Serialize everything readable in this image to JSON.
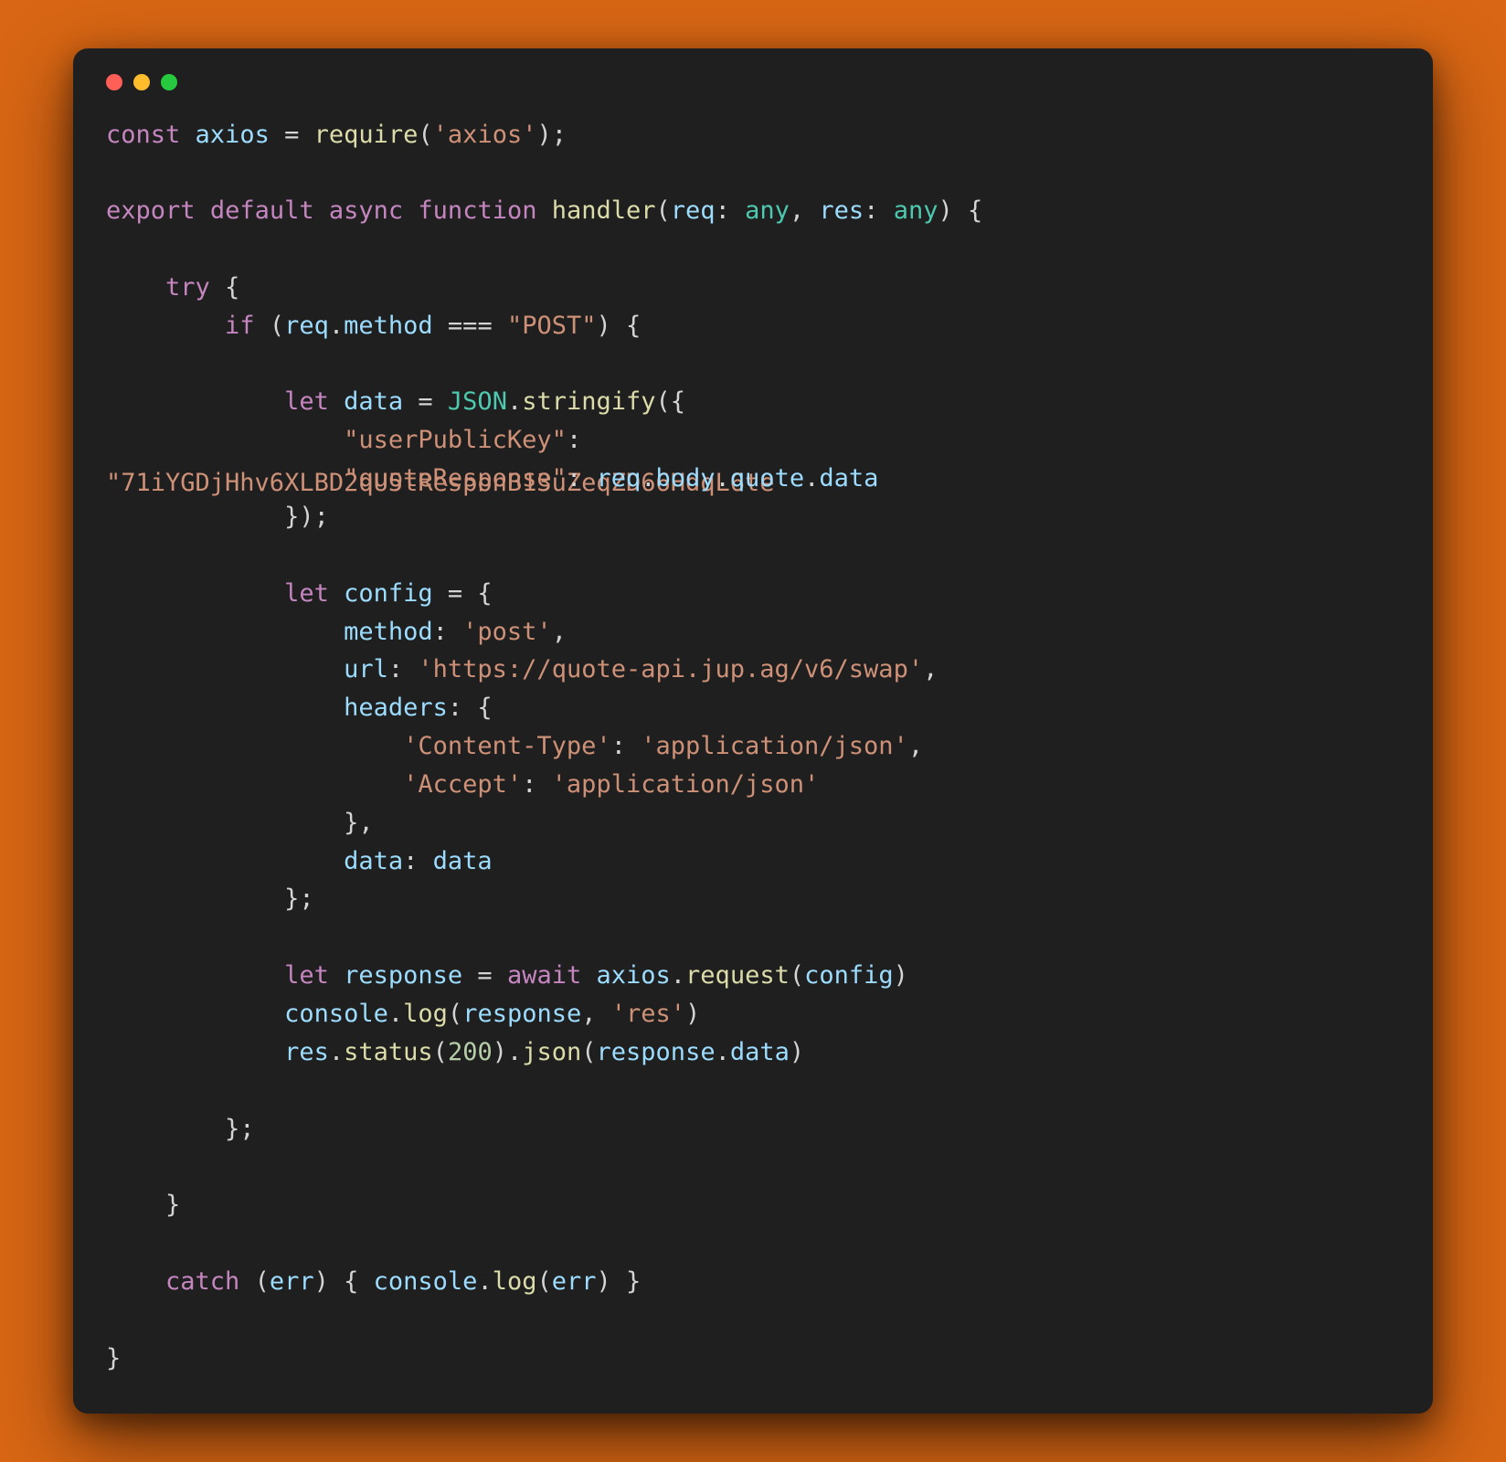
{
  "traffic_lights": {
    "red": "#ff5f56",
    "yellow": "#ffbd2e",
    "green": "#27c93f"
  },
  "code": {
    "l1": {
      "const": "const",
      "axios": "axios",
      "eq": " = ",
      "require": "require",
      "p1": "(",
      "str": "'axios'",
      "p2": ");"
    },
    "l3": {
      "export": "export",
      "default": "default",
      "async": "async",
      "function": "function",
      "handler": "handler",
      "p1": "(",
      "req": "req",
      "c1": ": ",
      "any1": "any",
      "comma": ", ",
      "res": "res",
      "c2": ": ",
      "any2": "any",
      "p2": ") {"
    },
    "l5": {
      "indent": "    ",
      "try": "try",
      "brace": " {"
    },
    "l6": {
      "indent": "        ",
      "if": "if",
      "p1": " (",
      "req": "req",
      "dot": ".",
      "method": "method",
      "eq": " === ",
      "str": "\"POST\"",
      "p2": ") {"
    },
    "l8": {
      "indent": "            ",
      "let": "let",
      "data": " data",
      "eq": " = ",
      "json": "JSON",
      "dot": ".",
      "stringify": "stringify",
      "p": "({"
    },
    "l9": {
      "indent": "                ",
      "key": "\"userPublicKey\"",
      "colon": ":"
    },
    "l10a": {
      "str_full": "\"71iYGDjHhv6XLBD2qU5tResponB13uZeqZD66HdqL6te",
      "indent2": "                ",
      "key2": "\"quoteResponse\"",
      "colon2": ": ",
      "req": "req",
      "d1": ".",
      "body": "body",
      "d2": ".",
      "quote": "quote",
      "d3": ".",
      "data": "data"
    },
    "l11": {
      "indent": "            ",
      "close": "});"
    },
    "l13": {
      "indent": "            ",
      "let": "let",
      "config": " config",
      "eq": " = {"
    },
    "l14": {
      "indent": "                ",
      "method": "method",
      "colon": ": ",
      "str": "'post'",
      "comma": ","
    },
    "l15": {
      "indent": "                ",
      "url": "url",
      "colon": ": ",
      "str": "'https://quote-api.jup.ag/v6/swap'",
      "comma": ","
    },
    "l16": {
      "indent": "                ",
      "headers": "headers",
      "colon": ": {"
    },
    "l17": {
      "indent": "                    ",
      "k": "'Content-Type'",
      "colon": ": ",
      "v": "'application/json'",
      "comma": ","
    },
    "l18": {
      "indent": "                    ",
      "k": "'Accept'",
      "colon": ": ",
      "v": "'application/json'"
    },
    "l19": {
      "indent": "                ",
      "close": "},"
    },
    "l20": {
      "indent": "                ",
      "data": "data",
      "colon": ": ",
      "data2": "data"
    },
    "l21": {
      "indent": "            ",
      "close": "};"
    },
    "l23": {
      "indent": "            ",
      "let": "let",
      "response": " response",
      "eq": " = ",
      "await": "await",
      "sp": " ",
      "axios": "axios",
      "dot": ".",
      "request": "request",
      "p1": "(",
      "config": "config",
      "p2": ")"
    },
    "l24": {
      "indent": "            ",
      "console": "console",
      "dot": ".",
      "log": "log",
      "p1": "(",
      "response": "response",
      "comma": ", ",
      "str": "'res'",
      "p2": ")"
    },
    "l25": {
      "indent": "            ",
      "res": "res",
      "d1": ".",
      "status": "status",
      "p1": "(",
      "num": "200",
      "p2": ").",
      "json": "json",
      "p3": "(",
      "response": "response",
      "d2": ".",
      "data": "data",
      "p4": ")"
    },
    "l27": {
      "indent": "        ",
      "close": "};"
    },
    "l29": {
      "indent": "    ",
      "close": "}"
    },
    "l31": {
      "indent": "    ",
      "catch": "catch",
      "p1": " (",
      "err": "err",
      "p2": ") { ",
      "console": "console",
      "dot": ".",
      "log": "log",
      "p3": "(",
      "err2": "err",
      "p4": ") }"
    },
    "l33": {
      "close": "}"
    }
  }
}
